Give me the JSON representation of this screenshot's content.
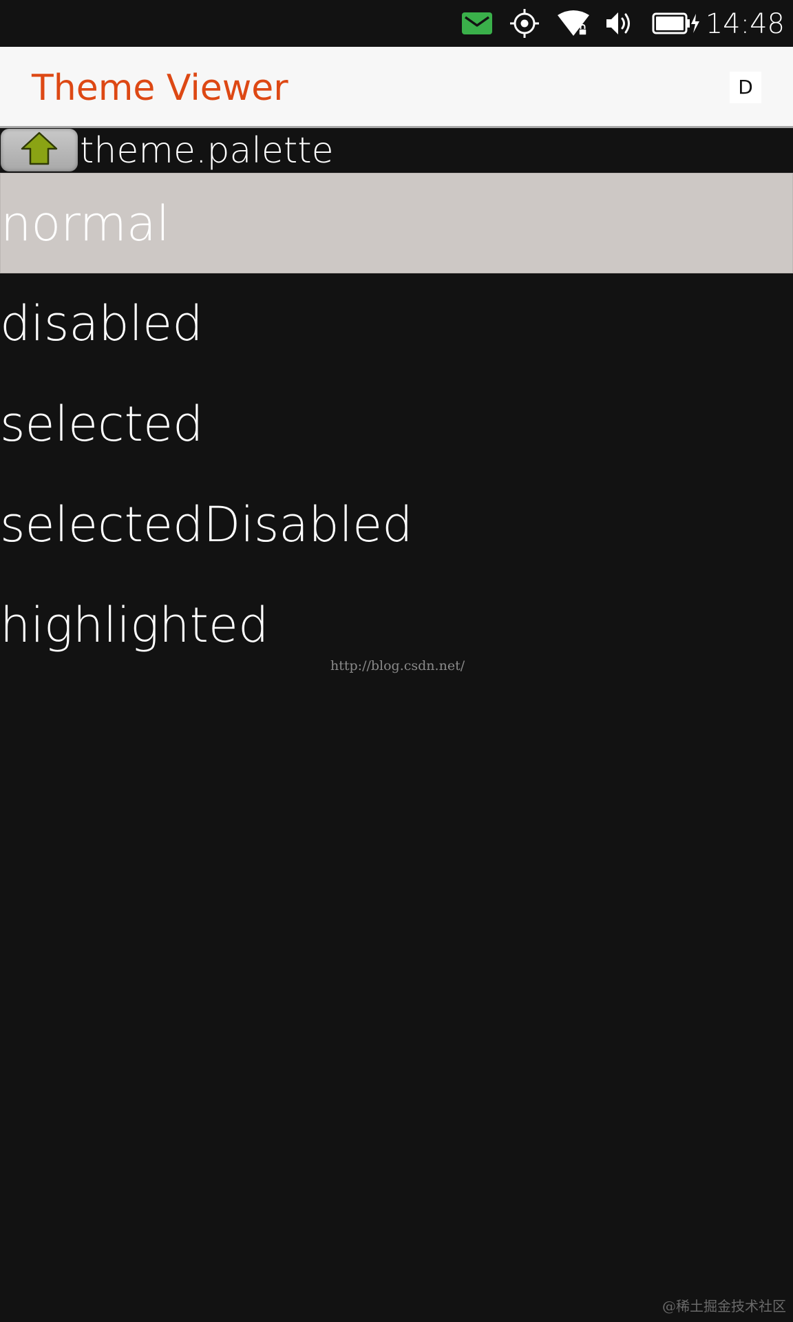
{
  "status_bar": {
    "icons": [
      "message-icon",
      "location-icon",
      "wifi-icon",
      "volume-icon",
      "battery-charging-icon"
    ],
    "time": "14:48",
    "message_color": "#3ab04a"
  },
  "header": {
    "title": "Theme Viewer",
    "action_label": "D",
    "title_color": "#dd4814"
  },
  "path": {
    "up_icon": "up-arrow-icon",
    "label": "theme.palette"
  },
  "list": {
    "selected_index": 0,
    "items": [
      {
        "label": "normal"
      },
      {
        "label": "disabled"
      },
      {
        "label": "selected"
      },
      {
        "label": "selectedDisabled"
      },
      {
        "label": "highlighted"
      }
    ]
  },
  "watermark": "http://blog.csdn.net/",
  "corner_mark": "@稀土掘金技术社区"
}
